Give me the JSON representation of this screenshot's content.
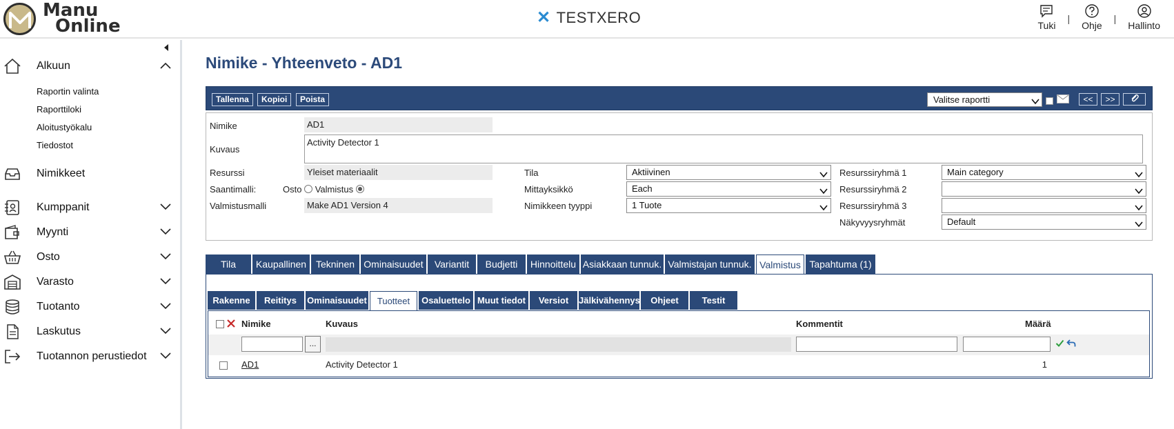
{
  "header": {
    "logo_line1": "Manu",
    "logo_line2": "Online",
    "brand_name": "TESTXERO",
    "brand_color": "#2a8bd1",
    "nav": [
      {
        "label": "Tuki",
        "icon": "chat-icon"
      },
      {
        "label": "Ohje",
        "icon": "help-icon"
      },
      {
        "label": "Hallinto",
        "icon": "user-icon"
      }
    ],
    "separator": "|"
  },
  "sidebar": {
    "items": [
      {
        "label": "Alkuun",
        "icon": "home-icon",
        "expanded": true
      },
      {
        "label": "Nimikkeet",
        "icon": "inbox-icon"
      },
      {
        "label": "Kumppanit",
        "icon": "contacts-icon"
      },
      {
        "label": "Myynti",
        "icon": "wallet-icon"
      },
      {
        "label": "Osto",
        "icon": "basket-icon"
      },
      {
        "label": "Varasto",
        "icon": "warehouse-icon"
      },
      {
        "label": "Tuotanto",
        "icon": "database-icon"
      },
      {
        "label": "Laskutus",
        "icon": "invoice-icon"
      },
      {
        "label": "Tuotannon perustiedot",
        "icon": "sign-out-icon"
      }
    ],
    "subitems": [
      "Raportin valinta",
      "Raporttiloki",
      "Aloitustyökalu",
      "Tiedostot"
    ]
  },
  "page": {
    "title": "Nimike - Yhteenveto - AD1"
  },
  "toolbar": {
    "save": "Tallenna",
    "copy": "Kopioi",
    "delete": "Poista",
    "report_select": "Valitse raportti",
    "prev": "<<",
    "next": ">>",
    "accent": "#2b4978"
  },
  "form": {
    "nimike_label": "Nimike",
    "nimike_value": "AD1",
    "kuvaus_label": "Kuvaus",
    "kuvaus_value": "Activity Detector 1",
    "resurssi_label": "Resurssi",
    "resurssi_value": "Yleiset materiaalit",
    "saantimalli_label": "Saantimalli:",
    "osto_label": "Osto",
    "valmistus_label": "Valmistus",
    "saantimalli_selected": "Valmistus",
    "valmistusmalli_label": "Valmistusmalli",
    "valmistusmalli_value": "Make AD1 Version 4",
    "tila_label": "Tila",
    "tila_value": "Aktiivinen",
    "mittayksikko_label": "Mittayksikkö",
    "mittayksikko_value": "Each",
    "tyyppi_label": "Nimikkeen tyyppi",
    "tyyppi_value": "1 Tuote",
    "rr1_label": "Resurssiryhmä 1",
    "rr1_value": "Main category",
    "rr2_label": "Resurssiryhmä 2",
    "rr2_value": "",
    "rr3_label": "Resurssiryhmä 3",
    "rr3_value": "",
    "nakyvyys_label": "Näkyvyysryhmät",
    "nakyvyys_value": "Default"
  },
  "tabs": [
    "Tila",
    "Kaupallinen",
    "Tekninen",
    "Ominaisuudet",
    "Variantit",
    "Budjetti",
    "Hinnoittelu",
    "Asiakkaan tunnuk.",
    "Valmistajan tunnuk.",
    "Valmistus",
    "Tapahtuma (1)"
  ],
  "active_tab": "Valmistus",
  "subtabs": [
    "Rakenne",
    "Reititys",
    "Ominaisuudet",
    "Tuotteet",
    "Osaluettelo",
    "Muut tiedot",
    "Versiot",
    "Jälkivähennys",
    "Ohjeet",
    "Testit"
  ],
  "active_subtab": "Tuotteet",
  "grid": {
    "columns": {
      "nimike": "Nimike",
      "kuvaus": "Kuvaus",
      "kommentit": "Kommentit",
      "maara": "Määrä"
    },
    "browse_button": "...",
    "rows": [
      {
        "nimike": "AD1",
        "kuvaus": "Activity Detector 1",
        "kommentit": "",
        "maara": "1"
      }
    ]
  }
}
